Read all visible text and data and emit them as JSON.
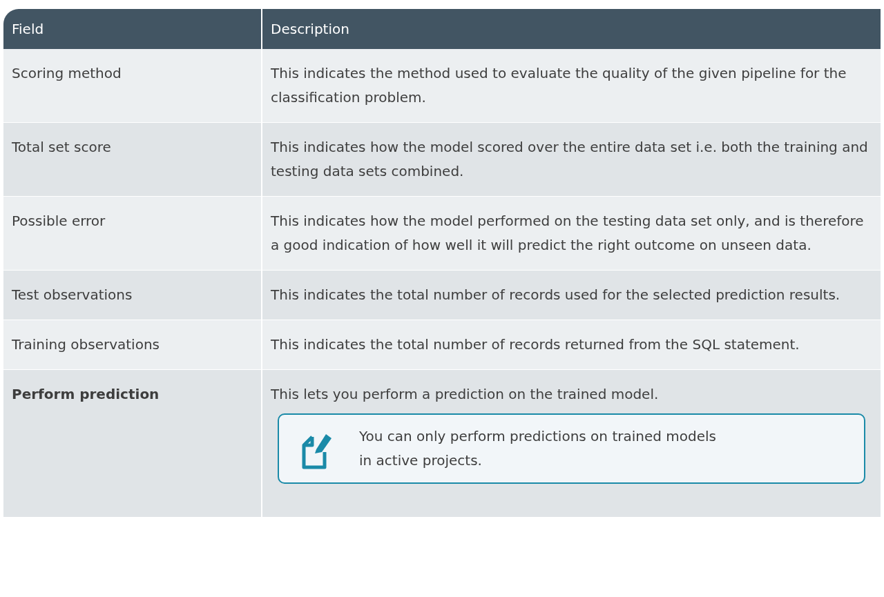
{
  "table": {
    "columns": [
      "Field",
      "Description"
    ],
    "rows": [
      {
        "field": "Scoring method",
        "bold": false,
        "description": "This indicates the method used to evaluate the quality of the given pipeline for the classification problem."
      },
      {
        "field": "Total set score",
        "bold": false,
        "description": "This indicates how the model scored over the entire data set i.e. both the training and testing data sets combined."
      },
      {
        "field": "Possible error",
        "bold": false,
        "description": "This indicates how the model performed on the testing data set only, and is therefore a good indication of how well it will predict the right outcome on unseen data."
      },
      {
        "field": "Test observations",
        "bold": false,
        "description": "This indicates the total number of records used for the selected prediction results."
      },
      {
        "field": "Training observations",
        "bold": false,
        "description": "This indicates the total number of records returned from the SQL statement."
      },
      {
        "field": "Perform prediction",
        "bold": true,
        "description": "This lets you perform a prediction on the trained model.",
        "note": "You can only perform predictions on trained models in active projects."
      }
    ]
  }
}
